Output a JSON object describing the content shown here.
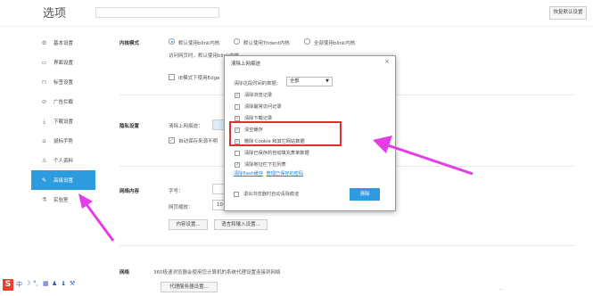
{
  "header": {
    "title": "选项",
    "reset_label": "恢复默认设置"
  },
  "sidebar": {
    "items": [
      {
        "icon": "gear-icon",
        "glyph": "⚙",
        "label": "基本设置"
      },
      {
        "icon": "window-icon",
        "glyph": "▭",
        "label": "界面设置"
      },
      {
        "icon": "tab-icon",
        "glyph": "⊓",
        "label": "标签设置"
      },
      {
        "icon": "shield-icon",
        "glyph": "⊘",
        "label": "广告拦截"
      },
      {
        "icon": "download-icon",
        "glyph": "⤓",
        "label": "下载设置"
      },
      {
        "icon": "mouse-icon",
        "glyph": "⌂",
        "label": "鼠标手势"
      },
      {
        "icon": "person-icon",
        "glyph": "♙",
        "label": "个人资料"
      },
      {
        "icon": "advanced-icon",
        "glyph": "✎",
        "label": "高级设置"
      },
      {
        "icon": "lab-icon",
        "glyph": "⚗",
        "label": "实验室"
      }
    ]
  },
  "main": {
    "kernel": {
      "label": "内核模式",
      "opt1": "默认使用blink内核",
      "opt2": "默认使用Trident内核",
      "opt3": "全部使用blink内核",
      "desc": "访问网页时，默认使用blink内核",
      "ie_check": "IE模式下使用Edge"
    },
    "privacy": {
      "label": "隐私设置",
      "clear_label": "清除上网痕迹：",
      "auto_check": "自动保存来源不明"
    },
    "web_content": {
      "label": "网络内容",
      "font_label": "字号：",
      "zoom_label": "网页缩放：",
      "zoom_value": "10",
      "content_btn": "内容设置...",
      "lang_btn": "语言和输入设置..."
    },
    "network": {
      "label": "网络",
      "desc": "360极速浏览器会使用您计算机的系统代理设置连接到网络",
      "proxy_btn": "代理服务器设置..."
    }
  },
  "dialog": {
    "title": "清除上网痕迹",
    "close": "×",
    "range_label": "清除这段时间的数据：",
    "range_value": "全部",
    "options": [
      {
        "label": "清除浏览记录",
        "checked": true
      },
      {
        "label": "清除最常访问记录",
        "checked": false
      },
      {
        "label": "清除下载记录",
        "checked": true
      },
      {
        "label": "清空缓存",
        "checked": true
      },
      {
        "label": "删除 Cookie 和其它网站数据",
        "checked": true
      },
      {
        "label": "清除已保存的自动填充表单数据",
        "checked": false
      },
      {
        "label": "清除地址栏下拉列表",
        "checked": true
      }
    ],
    "link1": "清除flash缓存",
    "link2": "管理已保存的密码",
    "footer_check": "退出浏览器时自动清除痕迹",
    "clear_button": "清除"
  },
  "footer": {
    "status": "···"
  },
  "colors": {
    "accent": "#2e9be0",
    "highlight_box": "#e03030",
    "arrow": "#e63ce6",
    "toolbar_s": "#e8402d"
  }
}
